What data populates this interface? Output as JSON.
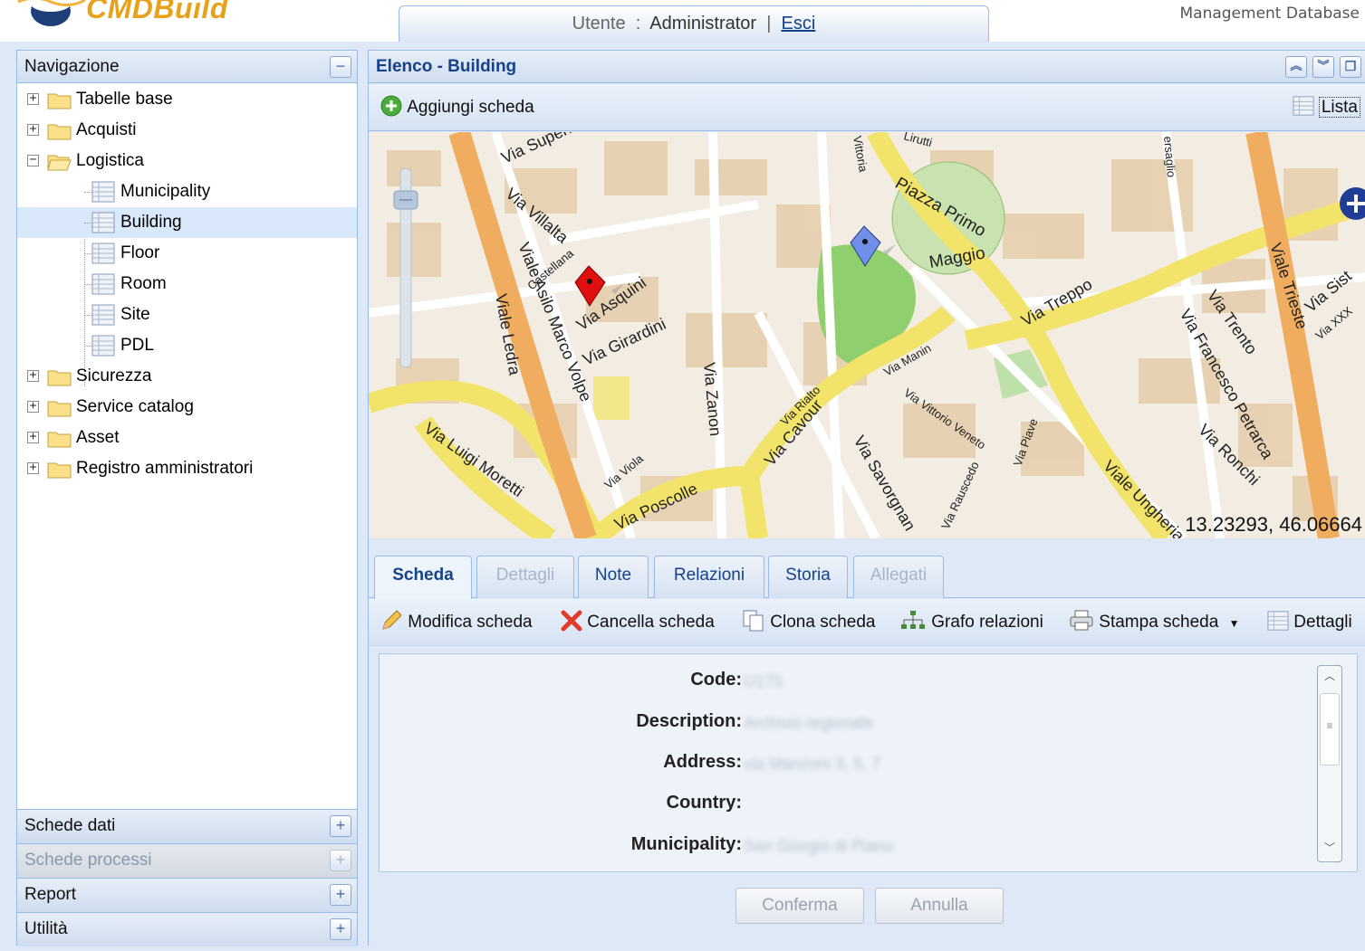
{
  "header": {
    "logo_text": "CMDBuild",
    "user_label": "Utente",
    "user_name": "Administrator",
    "logout_link": "Esci",
    "subtitle": "Management Database"
  },
  "nav": {
    "title": "Navigazione",
    "tree": [
      {
        "label": "Tabelle base",
        "type": "folder",
        "expanded": false
      },
      {
        "label": "Acquisti",
        "type": "folder",
        "expanded": false
      },
      {
        "label": "Logistica",
        "type": "folder",
        "expanded": true
      },
      {
        "label": "Municipality",
        "type": "class"
      },
      {
        "label": "Building",
        "type": "class",
        "selected": true
      },
      {
        "label": "Floor",
        "type": "class"
      },
      {
        "label": "Room",
        "type": "class"
      },
      {
        "label": "Site",
        "type": "class"
      },
      {
        "label": "PDL",
        "type": "class"
      },
      {
        "label": "Sicurezza",
        "type": "folder",
        "expanded": false
      },
      {
        "label": "Service catalog",
        "type": "folder",
        "expanded": false
      },
      {
        "label": "Asset",
        "type": "folder",
        "expanded": false
      },
      {
        "label": "Registro amministratori",
        "type": "folder",
        "expanded": false
      }
    ],
    "accordions": [
      {
        "label": "Schede dati",
        "enabled": true
      },
      {
        "label": "Schede processi",
        "enabled": false
      },
      {
        "label": "Report",
        "enabled": true
      },
      {
        "label": "Utilità",
        "enabled": true
      }
    ]
  },
  "main": {
    "title": "Elenco - Building",
    "add_card": "Aggiungi scheda",
    "list_button": "Lista",
    "map": {
      "coordinates": "13.23293, 46.06664",
      "streets": [
        "Via Superiore",
        "Via Villalta",
        "Castellana",
        "Via Asquini",
        "Via Girardini",
        "Viale Asilo Marco Volpe",
        "Viale Ledra",
        "Via Luigi Moretti",
        "Via Poscolle",
        "Via Zanon",
        "Via Viola",
        "Via Rialto",
        "Via Cavour",
        "Via Savorgnan",
        "Via Manin",
        "Via Vittorio Veneto",
        "Via Rauscedo",
        "Via Piave",
        "Piazza Primo Maggio",
        "Via Treppo",
        "Via Trento",
        "Via Francesco Petrarca",
        "Via Ronchi",
        "Viale Trieste",
        "Via Sist",
        "Via XXX",
        "Viale Ungheria",
        "Vittoria",
        "Lirutti",
        "ersaglio"
      ]
    },
    "tabs": [
      {
        "label": "Scheda",
        "state": "active"
      },
      {
        "label": "Dettagli",
        "state": "disabled"
      },
      {
        "label": "Note",
        "state": "normal"
      },
      {
        "label": "Relazioni",
        "state": "normal"
      },
      {
        "label": "Storia",
        "state": "normal"
      },
      {
        "label": "Allegati",
        "state": "disabled"
      }
    ],
    "card_toolbar": {
      "edit": "Modifica scheda",
      "delete": "Cancella scheda",
      "clone": "Clona scheda",
      "graph": "Grafo relazioni",
      "print": "Stampa scheda",
      "details": "Dettagli"
    },
    "form": {
      "fields": [
        {
          "label": "Code:",
          "value": "U175"
        },
        {
          "label": "Description:",
          "value": "Archivio regionale"
        },
        {
          "label": "Address:",
          "value": "via Manzoni 3, 5, 7"
        },
        {
          "label": "Country:",
          "value": ""
        },
        {
          "label": "Municipality:",
          "value": "San Giorgio di Piano"
        }
      ],
      "confirm": "Conferma",
      "cancel": "Annulla"
    }
  },
  "colors": {
    "panel_border": "#99bbe8",
    "header_text": "#15428b",
    "selected_row": "#d9e8fb",
    "marker_red": "#e01010",
    "marker_blue": "#6f8fe8"
  }
}
